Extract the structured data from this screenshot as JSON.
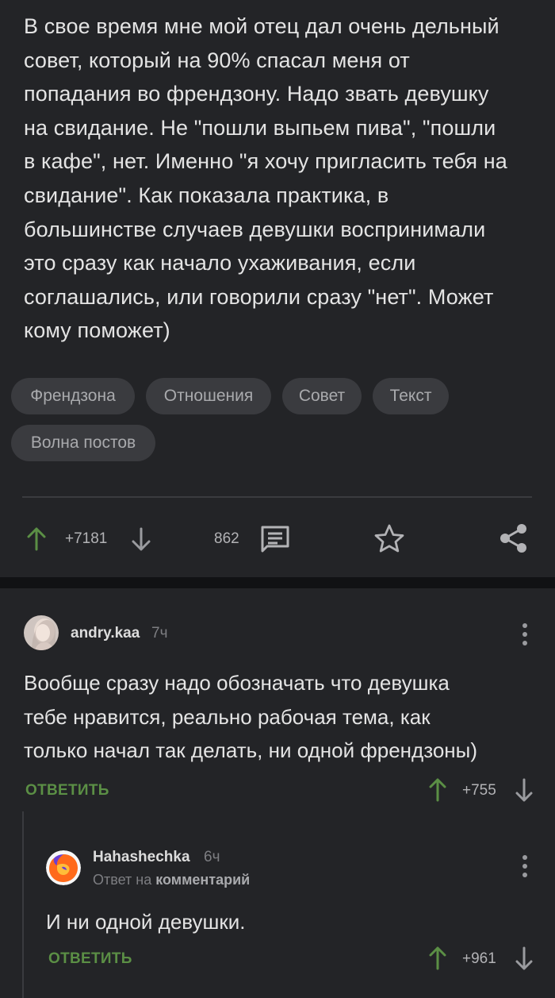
{
  "post": {
    "text_lines": [
      "В свое время мне мой отец дал очень дельный",
      "совет, который на 90% спасал меня от",
      "попадания во френдзону. Надо звать девушку",
      "на свидание. Не \"пошли выпьем пива\", \"пошли",
      "в кафе\", нет. Именно \"я хочу пригласить тебя на",
      "свидание\". Как показала практика, в",
      "большинстве случаев девушки воспринимали",
      "это сразу как начало ухаживания, если",
      "соглашались, или говорили сразу \"нет\". Может",
      "кому поможет)"
    ],
    "tags": [
      "Френдзона",
      "Отношения",
      "Совет",
      "Текст",
      "Волна постов"
    ],
    "rating": "+7181",
    "comments_count": "862"
  },
  "comments": [
    {
      "author": "andry.kaa",
      "time": "7ч",
      "text_lines": [
        "Вообще сразу надо обозначать что девушка",
        "тебе нравится, реально рабочая тема, как",
        "только начал так делать, ни одной френдзоны)"
      ],
      "reply_label": "ОТВЕТИТЬ",
      "rating": "+755"
    },
    {
      "author": "Hahashechka",
      "time": "6ч",
      "reply_to_prefix": "Ответ на",
      "reply_to_target": "комментарий",
      "text_lines": [
        "И ни одной девушки."
      ],
      "reply_label": "ОТВЕТИТЬ",
      "rating": "+961"
    }
  ],
  "colors": {
    "background": "#111214",
    "card": "#232427",
    "tag_bg": "#3a3b3f",
    "upvote_green": "#5b8f45",
    "text": "#e4e4e4",
    "muted": "#7d7e82"
  },
  "icons": [
    "upvote-arrow-icon",
    "downvote-arrow-icon",
    "comment-bubble-icon",
    "star-icon",
    "share-icon",
    "more-dots-icon",
    "avatar-image",
    "firefox-avatar-icon"
  ]
}
